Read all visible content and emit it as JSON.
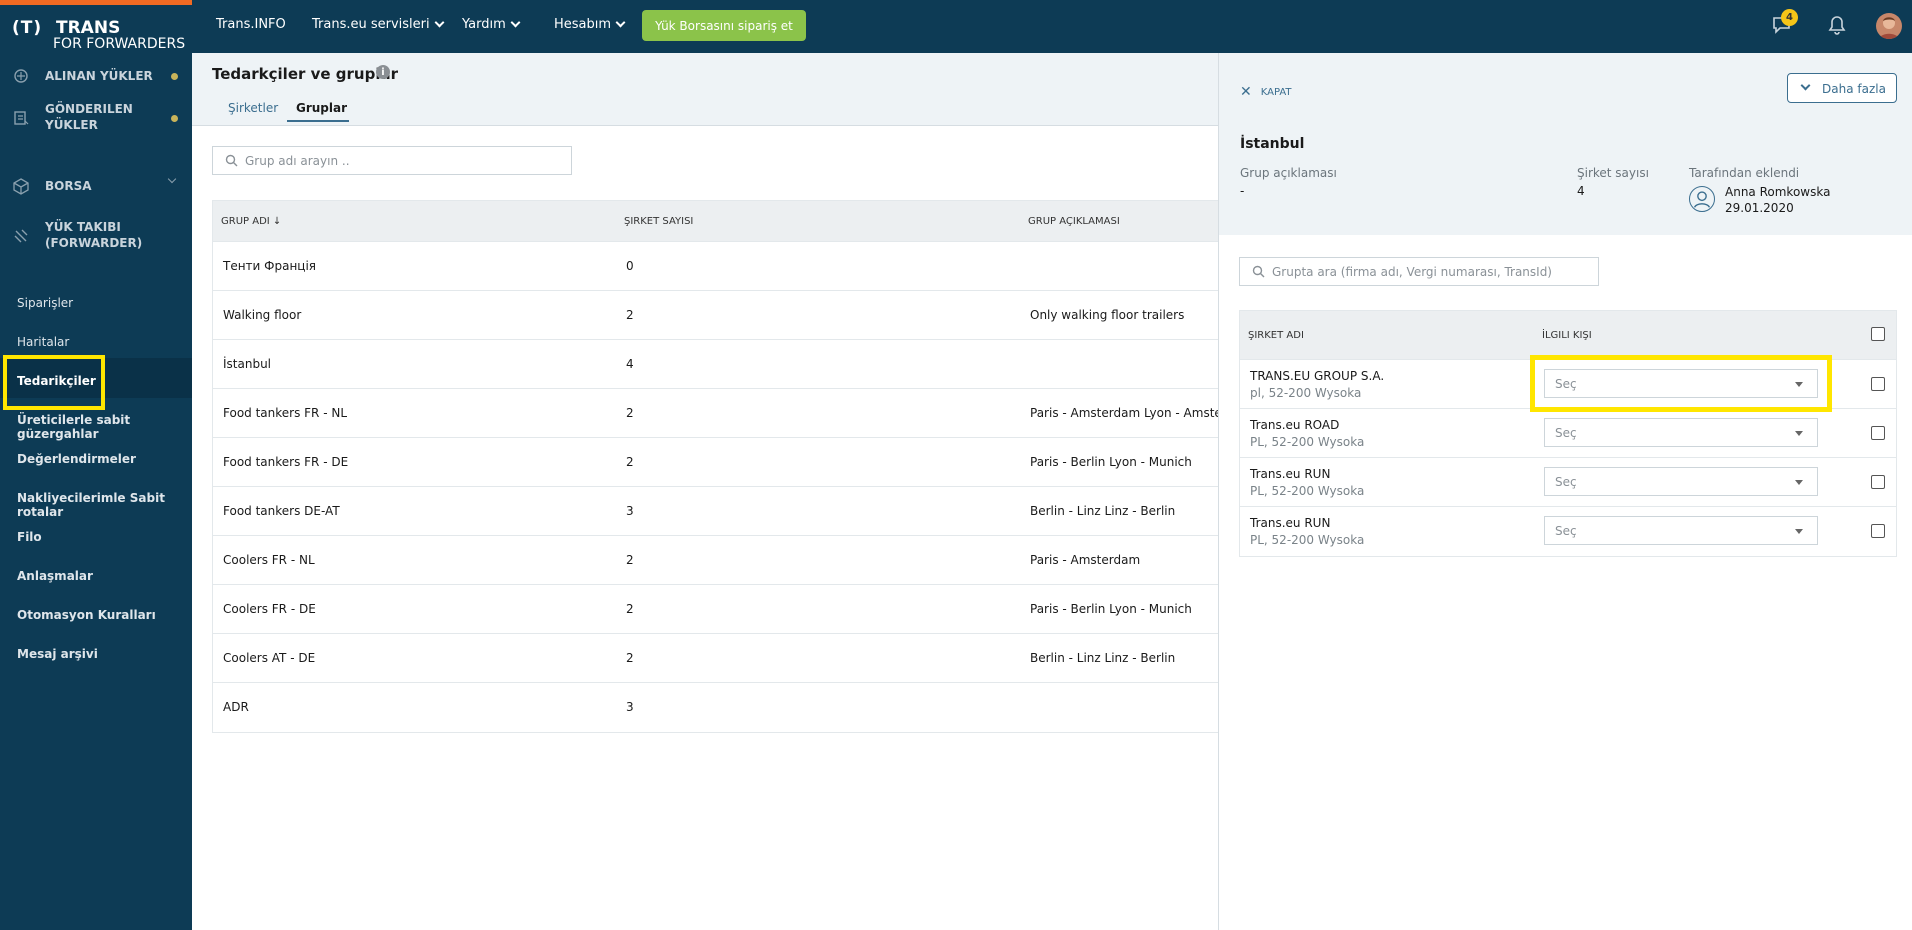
{
  "brand": {
    "mark": "(T)",
    "line1": "TRANS",
    "line2": "FOR FORWARDERS"
  },
  "topnav": {
    "items": [
      {
        "label": "Trans.INFO"
      },
      {
        "label": "Trans.eu servisleri"
      },
      {
        "label": "Yardım"
      },
      {
        "label": "Hesabım"
      }
    ],
    "cta": "Yük Borsasını sipariş et",
    "messages_badge": "4"
  },
  "sidebar": {
    "modules": [
      {
        "label": "ALINAN YÜKLER",
        "icon": "loads-icon"
      },
      {
        "label": "GÖNDERILEN YÜKLER",
        "icon": "sent-loads-icon"
      },
      {
        "label": "BORSA",
        "icon": "box-icon"
      },
      {
        "label": "YÜK TAKIBI (FORWARDER)",
        "icon": "satellite-icon"
      }
    ],
    "links": [
      "Siparişler",
      "Haritalar",
      "Tedarikçiler",
      "Üreticilerle sabit güzergahlar",
      "Değerlendirmeler",
      "Nakliyecilerimle Sabit rotalar",
      "Filo",
      "Anlaşmalar",
      "Otomasyon Kuralları",
      "Mesaj arşivi"
    ]
  },
  "main": {
    "title": "Tedarkçiler ve gruplar",
    "tabs": [
      "Şirketler",
      "Gruplar"
    ],
    "search_placeholder": "Grup adı arayın ..",
    "columns": [
      "GRUP ADI ↓",
      "ŞIRKET SAYISI",
      "GRUP AÇIKLAMASI"
    ],
    "rows": [
      {
        "name": "Тенти Франція",
        "count": "0",
        "desc": ""
      },
      {
        "name": "Walking floor",
        "count": "2",
        "desc": "Only walking floor trailers"
      },
      {
        "name": "İstanbul",
        "count": "4",
        "desc": ""
      },
      {
        "name": "Food tankers FR - NL",
        "count": "2",
        "desc": "Paris - Amsterdam Lyon - Amsterdam"
      },
      {
        "name": "Food tankers FR - DE",
        "count": "2",
        "desc": "Paris - Berlin Lyon - Munich"
      },
      {
        "name": "Food tankers DE-AT",
        "count": "3",
        "desc": "Berlin - Linz Linz - Berlin"
      },
      {
        "name": "Coolers FR - NL",
        "count": "2",
        "desc": "Paris - Amsterdam"
      },
      {
        "name": "Coolers FR - DE",
        "count": "2",
        "desc": "Paris - Berlin Lyon - Munich"
      },
      {
        "name": "Coolers AT - DE",
        "count": "2",
        "desc": "Berlin - Linz Linz - Berlin"
      },
      {
        "name": "ADR",
        "count": "3",
        "desc": ""
      }
    ]
  },
  "panel": {
    "close_label": "KAPAT",
    "more_label": "Daha fazla",
    "group_name": "İstanbul",
    "desc_label": "Grup açıklaması",
    "desc_value": "-",
    "count_label": "Şirket sayısı",
    "count_value": "4",
    "added_label": "Tarafından eklendi",
    "added_by": "Anna Romkowska",
    "added_date": "29.01.2020",
    "search_placeholder": "Grupta ara (firma adı, Vergi numarası, TransId)",
    "columns": [
      "ŞIRKET ADI",
      "İLGILI KIŞI"
    ],
    "rows": [
      {
        "name": "TRANS.EU GROUP S.A.",
        "address": "pl, 52-200 Wysoka",
        "select": "Seç"
      },
      {
        "name": "Trans.eu ROAD",
        "address": "PL, 52-200 Wysoka",
        "select": "Seç"
      },
      {
        "name": "Trans.eu RUN",
        "address": "PL, 52-200 Wysoka",
        "select": "Seç"
      },
      {
        "name": "Trans.eu RUN",
        "address": "PL, 52-200 Wysoka",
        "select": "Seç"
      }
    ]
  },
  "colors": {
    "navy": "#0d3b55",
    "accent": "#f06a23",
    "cta": "#8bc34a",
    "highlight": "#ffe600",
    "link": "#3b6e8f"
  }
}
